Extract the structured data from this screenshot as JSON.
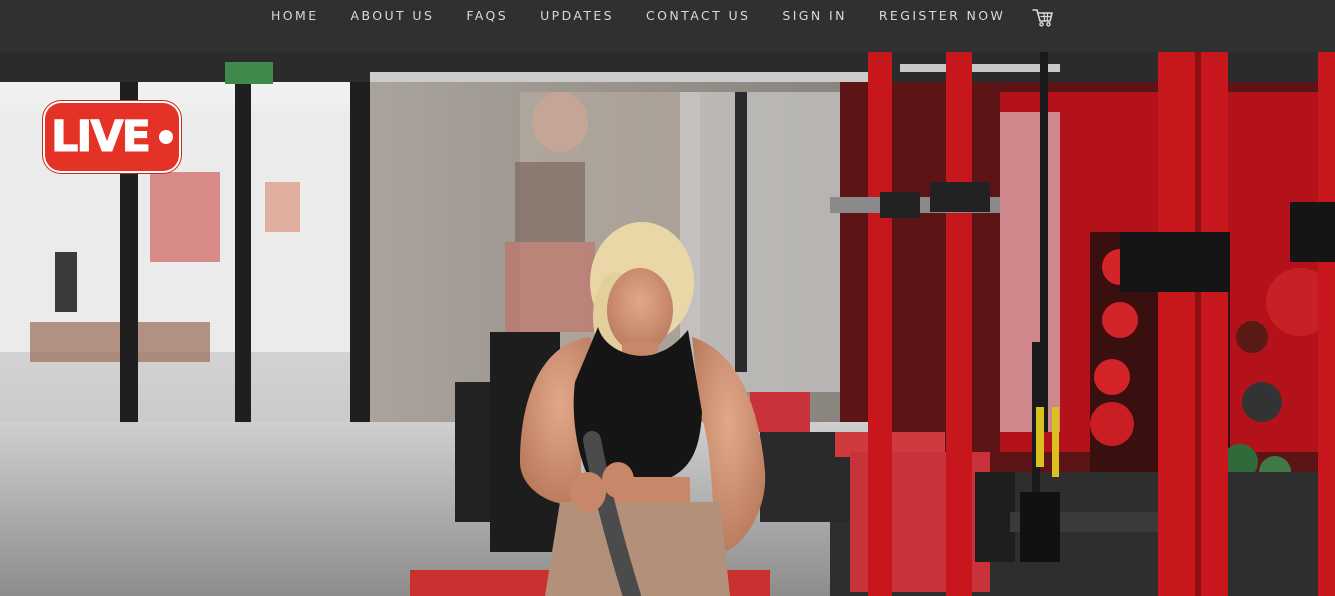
{
  "nav": {
    "items": [
      {
        "label": "HOME",
        "name": "nav-home"
      },
      {
        "label": "ABOUT US",
        "name": "nav-about-us"
      },
      {
        "label": "FAQS",
        "name": "nav-faqs"
      },
      {
        "label": "UPDATES",
        "name": "nav-updates"
      },
      {
        "label": "CONTACT US",
        "name": "nav-contact-us"
      },
      {
        "label": "SIGN IN",
        "name": "nav-sign-in"
      },
      {
        "label": "REGISTER NOW",
        "name": "nav-register-now"
      }
    ],
    "cart_icon": "shopping-cart-icon"
  },
  "hero": {
    "badge_text": "LIVE",
    "badge_color": "#e53227",
    "scene": "woman training with battle ropes in a gym with red power racks"
  },
  "colors": {
    "nav_bg": "#303030",
    "nav_text": "#d9d9d9",
    "accent_red": "#c8161d"
  }
}
